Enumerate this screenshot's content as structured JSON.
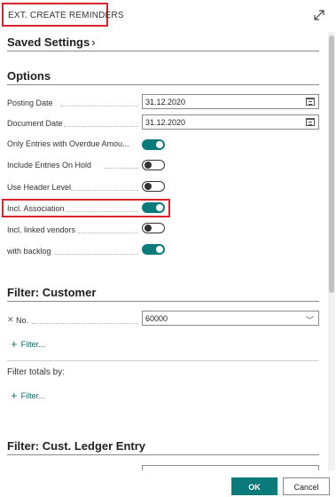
{
  "dialog": {
    "title": "EXT. CREATE REMINDERS"
  },
  "saved_settings": {
    "label": "Saved Settings",
    "chevron": "›"
  },
  "options": {
    "heading": "Options",
    "posting_date": {
      "label": "Posting Date",
      "value": "31.12.2020"
    },
    "document_date": {
      "label": "Document Date",
      "value": "31.12.2020"
    },
    "toggles": [
      {
        "label": "Only Entries with Overdue Amou...",
        "on": true
      },
      {
        "label": "Include Entries On Hold",
        "on": false
      },
      {
        "label": "Use Header Level",
        "on": false
      },
      {
        "label": "Incl. Association",
        "on": true
      },
      {
        "label": "Incl. linked vendors",
        "on": false
      },
      {
        "label": "with backlog",
        "on": true
      }
    ]
  },
  "filter_customer": {
    "heading": "Filter: Customer",
    "no_label": "No.",
    "no_value": "60000",
    "add_filter": "Filter..."
  },
  "filter_totals": {
    "label": "Filter totals by:",
    "add_filter": "Filter..."
  },
  "filter_ledger": {
    "heading": "Filter: Cust. Ledger Entry"
  },
  "footer": {
    "ok_label": "OK",
    "cancel_label": "Cancel"
  },
  "colors": {
    "accent": "#0b7a7a",
    "highlight": "#d9232d"
  }
}
